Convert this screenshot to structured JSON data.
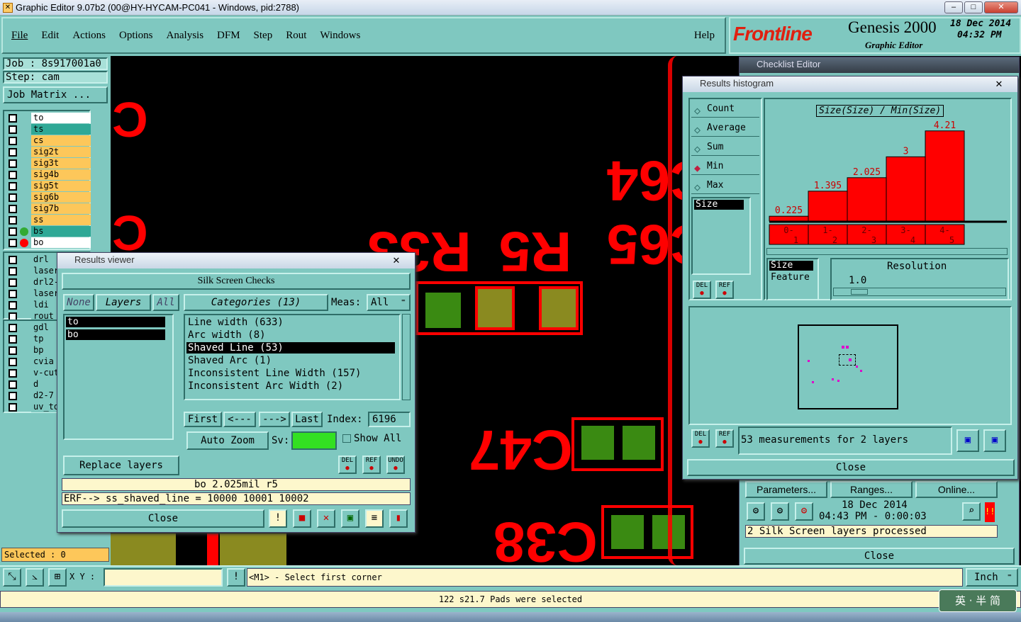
{
  "app": {
    "title": "Graphic Editor 9.07b2 (00@HY-HYCAM-PC041 - Windows, pid:2788)"
  },
  "menu": [
    "File",
    "Edit",
    "Actions",
    "Options",
    "Analysis",
    "DFM",
    "Step",
    "Rout",
    "Windows"
  ],
  "help": "Help",
  "brand": {
    "logo": "Frontline",
    "product": "Genesis 2000",
    "subtitle": "Graphic Editor",
    "date": "18 Dec 2014",
    "time": "04:32 PM"
  },
  "job": {
    "job_label": "Job : 8s917001a0",
    "step_label": "Step: cam",
    "matrix_button": "Job Matrix ..."
  },
  "layers_board": [
    "to",
    "ts",
    "cs",
    "sig2t",
    "sig3t",
    "sig4b",
    "sig5t",
    "sig6b",
    "sig7b",
    "ss",
    "bs",
    "bo"
  ],
  "layers_drill": [
    "drl",
    "laser",
    "drl2-",
    "laser",
    "ldi",
    "rout"
  ],
  "layers_misc": [
    "gdl",
    "tp",
    "bp",
    "cvia",
    "v-cut",
    "d",
    "d2-7",
    "uv_to"
  ],
  "selected": "Selected : 0",
  "bottom": {
    "xy_label": "X Y :",
    "prompt": "<M1> - Select first corner",
    "status": "122 s21.7 Pads were selected",
    "units": "Inch",
    "ime": "英 · 半 简"
  },
  "canvas_labels": {
    "r33": "R33",
    "r5": "R5",
    "c64": "C64",
    "c65": "C65",
    "c47": "C47",
    "c38": "C38",
    "c": "C"
  },
  "results_viewer": {
    "title": "Results viewer",
    "heading": "Silk Screen Checks",
    "none": "None",
    "layers": "Layers",
    "all": "All",
    "layer_list": [
      "to",
      "bo"
    ],
    "categories": "Categories (13)",
    "meas_label": "Meas:",
    "meas_value": "All",
    "category_items": [
      "Line width (633)",
      "Arc width (8)",
      "Shaved Line (53)",
      "Shaved Arc (1)",
      "Inconsistent Line Width (157)",
      "Inconsistent Arc Width (2)"
    ],
    "first": "First",
    "prev": "<---",
    "next": "--->",
    "last": "Last",
    "index_label": "Index:",
    "index_value": "6196",
    "auto_zoom": "Auto Zoom",
    "sv_label": "Sv:",
    "show_all": "Show All",
    "replace_layers": "Replace layers",
    "info_line": "bo 2.025mil   r5",
    "erf_line": "ERF--> ss_shaved_line = 10000 10001 10002",
    "close": "Close",
    "del": "DEL",
    "ref": "REF",
    "undo": "UNDO"
  },
  "checklist_editor": {
    "title": "Checklist Editor",
    "params": "Parameters...",
    "ranges": "Ranges...",
    "online": "Online...",
    "date": "18 Dec 2014",
    "time": "04:43 PM - 0:00:03",
    "message": "2 Silk Screen layers processed",
    "close": "Close"
  },
  "histogram": {
    "title": "Results histogram",
    "options": [
      "Count",
      "Average",
      "Sum",
      "Min",
      "Max"
    ],
    "selected_option": "Min",
    "attr": "Size",
    "formula": "Size(Size) / Min(Size)",
    "size_label": "Size",
    "feature_label": "Feature",
    "resolution_label": "Resolution",
    "resolution_value": "1.0",
    "measurements": "53 measurements for 2 layers",
    "close": "Close",
    "del": "DEL",
    "ref": "REF"
  },
  "chart_data": {
    "type": "bar",
    "title": "Size(Size) / Min(Size)",
    "categories": [
      "0-1",
      "1-2",
      "2-3",
      "3-4",
      "4-5"
    ],
    "values": [
      0.225,
      1.395,
      2.025,
      3,
      4.21
    ],
    "value_labels": [
      "0.225",
      "1.395",
      "2.025",
      "3",
      "4.21"
    ],
    "ylim": [
      0,
      4.5
    ],
    "colors": {
      "bar": "#ff0000"
    }
  }
}
